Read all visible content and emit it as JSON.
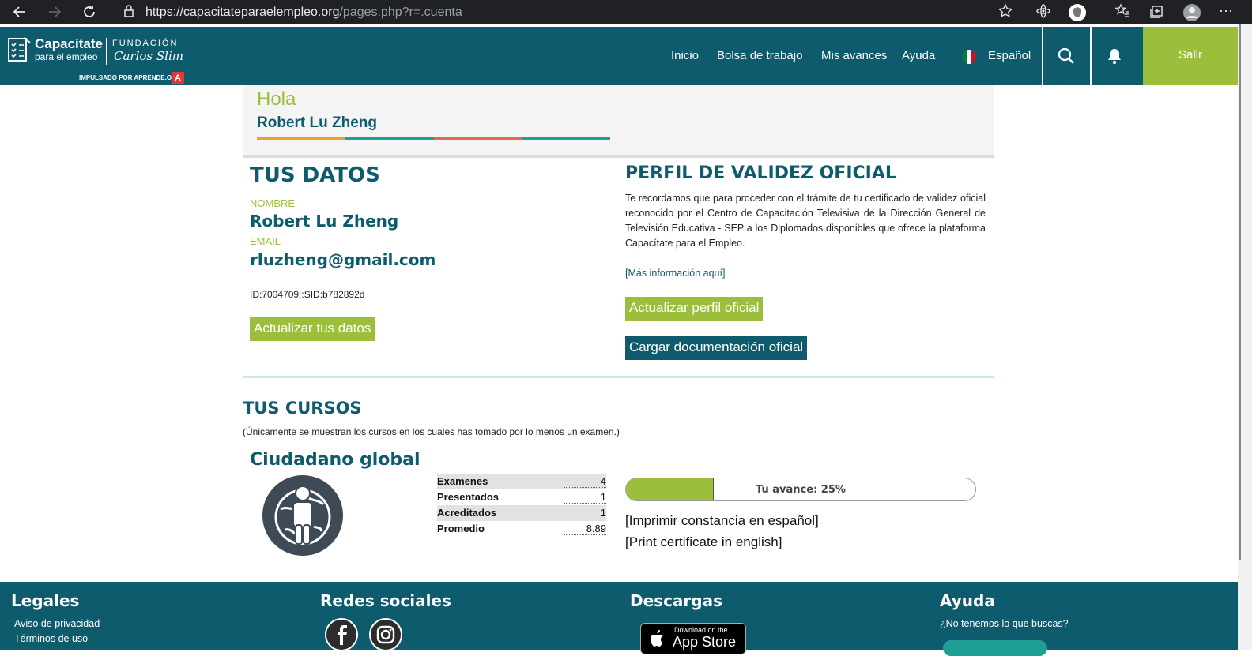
{
  "browser": {
    "url_host": "https://capacitateparaelempleo.org",
    "url_path": "/pages.php?r=.cuenta"
  },
  "header": {
    "logo": {
      "brand_line1": "Capacítate",
      "brand_line2": "para el empleo",
      "foundation_line1": "FUNDACIÓN",
      "foundation_line2": "Carlos Slim",
      "powered": "IMPULSADO POR APRENDE.ORG",
      "powered_badge": "A"
    },
    "menu": [
      "Inicio",
      "Bolsa de trabajo",
      "Mis avances",
      "Ayuda"
    ],
    "language": "Español",
    "logout": "Salir"
  },
  "hello": {
    "greeting": "Hola",
    "name": "Robert Lu Zheng",
    "stripe_colors": [
      "#f0a030",
      "#1f9e96",
      "#e8674a",
      "#1f9e96"
    ]
  },
  "tus_datos": {
    "title": "TUS DATOS",
    "name_label": "NOMBRE",
    "name_value": "Robert Lu Zheng",
    "email_label": "EMAIL",
    "email_value": "rluzheng@gmail.com",
    "ids": "ID:7004709::SID:b782892d",
    "update_button": "Actualizar tus datos"
  },
  "perfil": {
    "title": "PERFIL DE VALIDEZ OFICIAL",
    "description": "Te recordamos que para proceder con el trámite de tu certificado de validez oficial reconocido por el Centro de Capacitación Televisiva de la Dirección General de Televisión Educativa - SEP a los Diplomados disponibles que ofrece la plataforma Capacítate para el Empleo.",
    "more_info": "[Más información aquí]",
    "update_button": "Actualizar perfil oficial",
    "upload_button": "Cargar documentación oficial"
  },
  "cursos": {
    "title": "TUS CURSOS",
    "note": "(Únicamente se muestran los cursos en los cuales has tomado por lo menos un examen.)",
    "items": [
      {
        "name": "Ciudadano global",
        "icon": "globe-person-icon",
        "stats": [
          {
            "label": "Examenes",
            "value": "4"
          },
          {
            "label": "Presentados",
            "value": "1"
          },
          {
            "label": "Acreditados",
            "value": "1"
          },
          {
            "label": "Promedio",
            "value": "8.89"
          }
        ],
        "progress_percent": 25,
        "progress_label": "Tu avance: 25%",
        "print_es": "[Imprimir constancia en español]",
        "print_en": "[Print certificate in english]"
      }
    ]
  },
  "footer": {
    "legales": {
      "title": "Legales",
      "links": [
        "Aviso de privacidad",
        "Términos de uso"
      ]
    },
    "redes": {
      "title": "Redes sociales",
      "icons": [
        "facebook-icon",
        "instagram-icon"
      ]
    },
    "descargas": {
      "title": "Descargas",
      "appstore_line1": "Download on the",
      "appstore_line2": "App Store"
    },
    "ayuda": {
      "title": "Ayuda",
      "text": "¿No tenemos lo que buscas?"
    }
  },
  "colors": {
    "primary": "#0e5b6d",
    "accent_green": "#9bbf3b"
  }
}
